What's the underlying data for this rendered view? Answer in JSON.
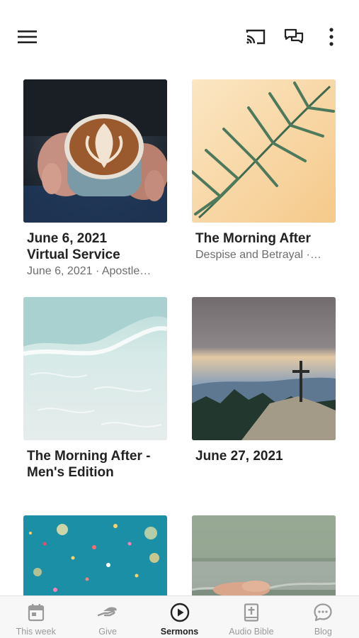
{
  "status_bar": {
    "label": ""
  },
  "app_bar": {
    "menu_icon": "hamburger-menu-icon",
    "actions": [
      "cast-icon",
      "chat-icon",
      "more-vert-icon"
    ]
  },
  "sermons": [
    {
      "title": "June 6, 2021\nVirtual Service",
      "subtitle": "June 6, 2021 · Apostle…",
      "image": "latte-art-coffee-cup"
    },
    {
      "title": "The Morning After",
      "subtitle": "Despise and Betrayal ·…",
      "image": "palm-leaf-shadow"
    },
    {
      "title": "The Morning After -\nMen's Edition",
      "subtitle": "",
      "image": "ocean-water"
    },
    {
      "title": "June 27, 2021",
      "subtitle": "",
      "image": "mountain-cross"
    },
    {
      "title": "",
      "subtitle": "",
      "image": "confetti-blue"
    },
    {
      "title": "",
      "subtitle": "",
      "image": "hands-lake"
    }
  ],
  "bottom_nav": [
    {
      "label": "This week",
      "icon": "calendar-icon",
      "active": false
    },
    {
      "label": "Give",
      "icon": "give-hand-icon",
      "active": false
    },
    {
      "label": "Sermons",
      "icon": "play-circle-icon",
      "active": true
    },
    {
      "label": "Audio Bible",
      "icon": "bible-icon",
      "active": false
    },
    {
      "label": "Blog",
      "icon": "speech-bubble-icon",
      "active": false
    }
  ],
  "colors": {
    "active_nav": "#222222",
    "inactive_nav": "#9a9a9a",
    "nav_bg": "#f7f7f7"
  }
}
